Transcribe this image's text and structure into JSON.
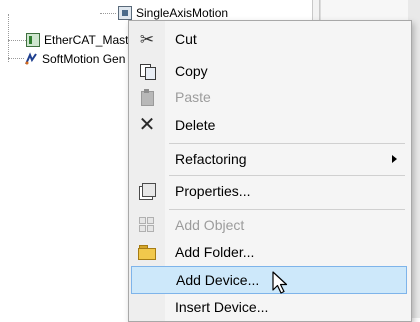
{
  "tree": {
    "nodes": [
      {
        "id": "axis",
        "label": "SingleAxisMotion",
        "icon": "axis-module-icon"
      },
      {
        "id": "ecat",
        "label": "EtherCAT_Mast",
        "icon": "ethercat-master-icon"
      },
      {
        "id": "sm",
        "label": "SoftMotion Gen",
        "icon": "softmotion-icon"
      }
    ]
  },
  "context_menu": {
    "items": [
      {
        "label": "Cut",
        "icon": "scissors-icon",
        "enabled": true
      },
      {
        "label": "Copy",
        "icon": "copy-icon",
        "enabled": true
      },
      {
        "label": "Paste",
        "icon": "clipboard-icon",
        "enabled": false
      },
      {
        "label": "Delete",
        "icon": "delete-x-icon",
        "enabled": true
      },
      {
        "label": "Refactoring",
        "icon": "",
        "enabled": true,
        "submenu": true
      },
      {
        "label": "Properties...",
        "icon": "properties-icon",
        "enabled": true
      },
      {
        "label": "Add Object",
        "icon": "add-object-icon",
        "enabled": false
      },
      {
        "label": "Add Folder...",
        "icon": "folder-icon",
        "enabled": true
      },
      {
        "label": "Add Device...",
        "icon": "",
        "enabled": true,
        "highlighted": true
      },
      {
        "label": "Insert Device...",
        "icon": "",
        "enabled": true
      }
    ]
  },
  "colors": {
    "highlight_fill": "#cde8fa",
    "highlight_border": "#7eb4ea",
    "disabled_text": "#9c9c9c"
  }
}
